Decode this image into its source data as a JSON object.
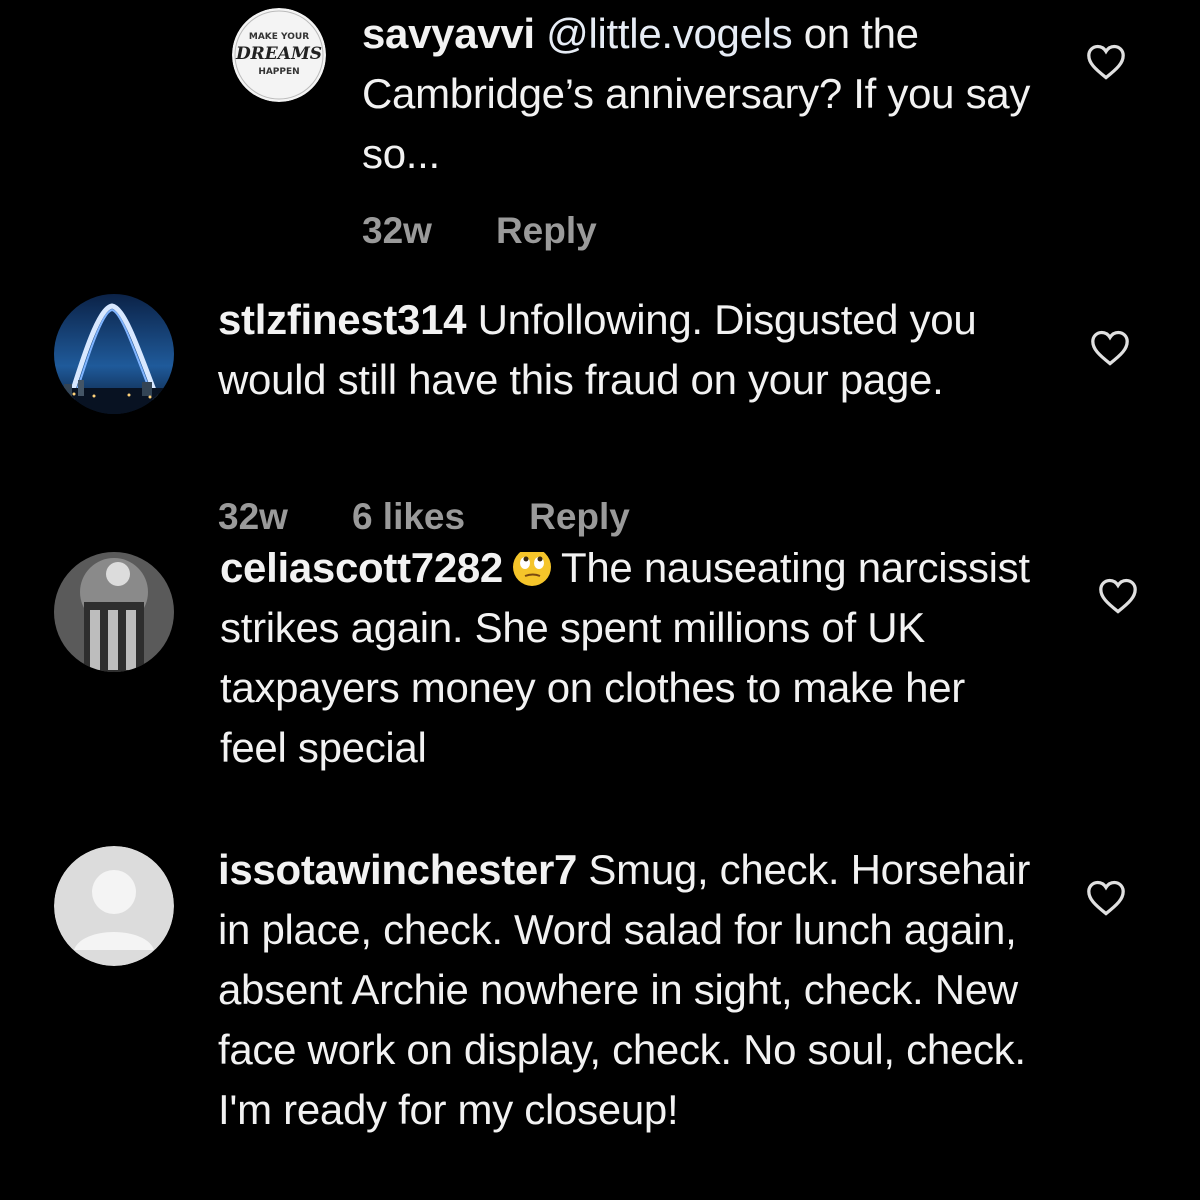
{
  "comments": [
    {
      "username": "savyavvi",
      "mention": "@little.vogels",
      "text": " on the Cambridge’s anniversary? If you say so...",
      "time": "32w",
      "likes": "",
      "reply": "Reply",
      "avatar_logo": {
        "line1": "MAKE YOUR",
        "line2": "DREAMS",
        "line3": "HAPPEN"
      }
    },
    {
      "username": "stlzfinest314",
      "text": " Unfollowing. Disgusted you would still have this fraud on your page.",
      "time": "32w",
      "likes": "6 likes",
      "reply": "Reply"
    },
    {
      "username": "celiascott7282",
      "emoji": "🙄",
      "text": "The nauseating narcissist strikes again. She spent millions of UK taxpayers money on clothes to make her feel special"
    },
    {
      "username": "issotawinchester7",
      "text": " Smug, check. Horsehair in place, check.  Word salad for lunch again, absent Archie nowhere in sight, check.  New face work on display, check.  No soul, check.  I'm ready for my closeup!"
    }
  ],
  "colors": {
    "background": "#000000",
    "text": "#f2f2f2",
    "meta": "#9a9a9a",
    "heart": "#e0e0e0"
  },
  "icons": {
    "like": "heart-outline-icon"
  }
}
